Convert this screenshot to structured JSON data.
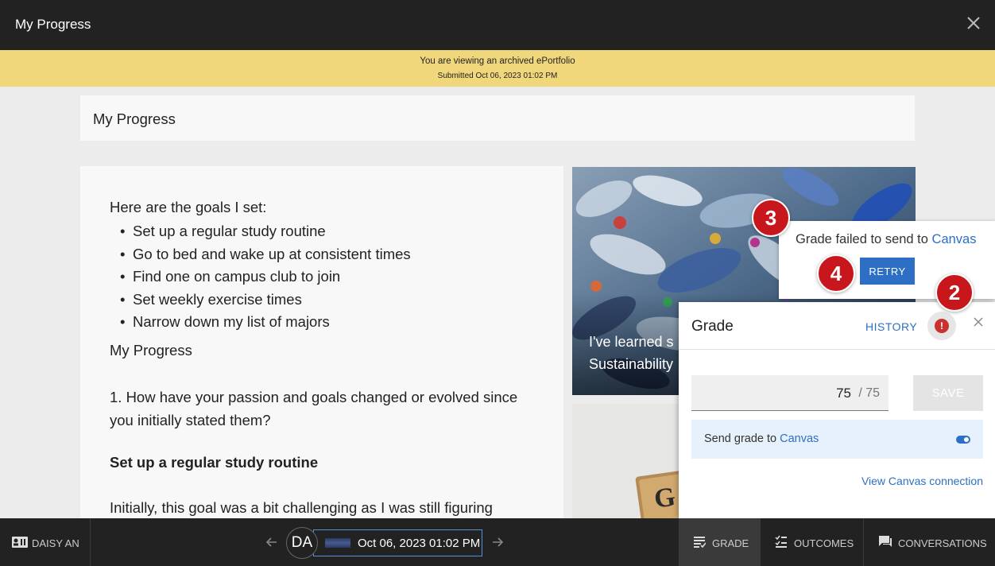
{
  "topbar": {
    "title": "My Progress"
  },
  "banner": {
    "line1": "You are viewing an archived ePortfolio",
    "line2": "Submitted Oct 06, 2023 01:02 PM"
  },
  "page": {
    "header": "My Progress",
    "goals_intro": "Here are the goals I set:",
    "goals": [
      "Set up a regular study routine",
      "Go to bed and wake up at consistent times",
      "Find one on campus club to join",
      "Set weekly exercise times",
      "Narrow down my list of majors"
    ],
    "subheading": "My Progress",
    "question": "1. How have your passion and goals changed or evolved since you initially stated them?",
    "goal_heading": "Set up a regular study routine",
    "paragraph": "Initially, this goal was a bit challenging as I was still figuring",
    "image_caption_line1": "I've learned s",
    "image_caption_line2": "Sustainability"
  },
  "grade_panel": {
    "title": "Grade",
    "history_label": "HISTORY",
    "error_icon": "!",
    "score": "75",
    "max_score": "/ 75",
    "save_label": "SAVE",
    "send_label": "Send grade to ",
    "send_link": "Canvas",
    "send_enabled": true,
    "view_connection": "View Canvas connection"
  },
  "error_popup": {
    "message": "Grade failed to send to ",
    "link": "Canvas",
    "retry_label": "RETRY"
  },
  "callouts": {
    "b2": "2",
    "b3": "3",
    "b4": "4"
  },
  "bottombar": {
    "student_name": "DAISY AN",
    "avatar_initials": "DA",
    "submission_date": "Oct 06, 2023 01:02 PM",
    "tabs": {
      "grade": "GRADE",
      "outcomes": "OUTCOMES",
      "conversations": "CONVERSATIONS"
    }
  },
  "colors": {
    "accent": "#2d6fc4",
    "banner": "#f1d77c",
    "callout": "#c8171c",
    "error": "#c9332f",
    "topbar": "#222222"
  }
}
